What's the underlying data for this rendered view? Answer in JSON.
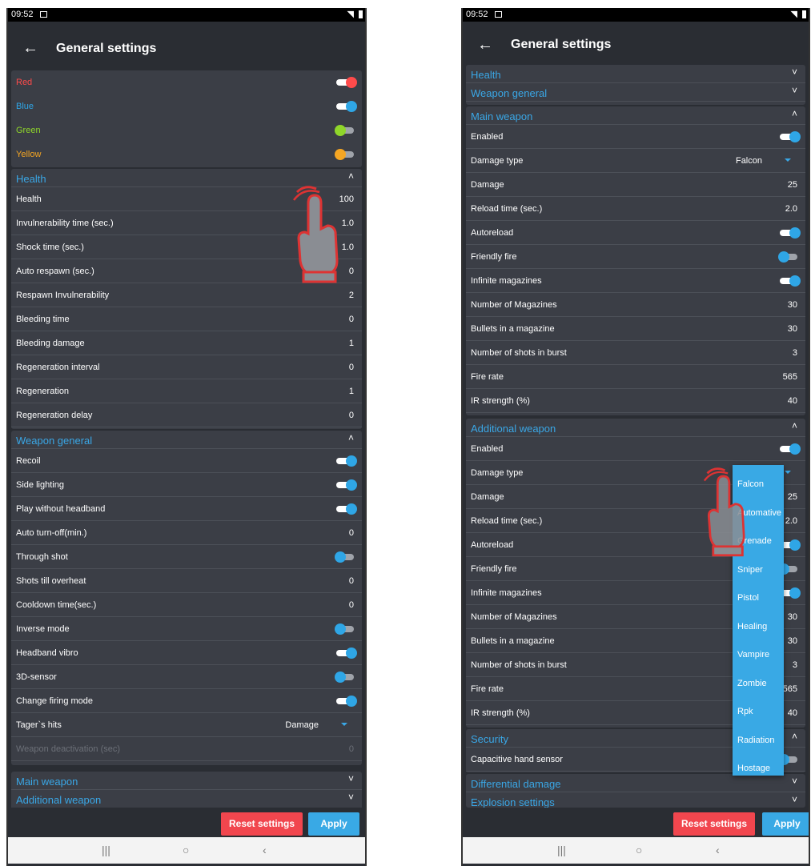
{
  "status": {
    "time": "09:52"
  },
  "left": {
    "title": "General settings",
    "colors": [
      {
        "label": "Red",
        "color": "#ff4b4b",
        "on": true
      },
      {
        "label": "Blue",
        "color": "#2fa6e6",
        "on": true
      },
      {
        "label": "Green",
        "color": "#8fd62a",
        "on": false
      },
      {
        "label": "Yellow",
        "color": "#f5a623",
        "on": false
      }
    ],
    "health": {
      "title": "Health",
      "rows": [
        {
          "label": "Health",
          "value": "100"
        },
        {
          "label": "Invulnerability time (sec.)",
          "value": "1.0"
        },
        {
          "label": "Shock time (sec.)",
          "value": "1.0"
        },
        {
          "label": "Auto respawn (sec.)",
          "value": "0"
        },
        {
          "label": "Respawn Invulnerability",
          "value": "2"
        },
        {
          "label": "Bleeding time",
          "value": "0"
        },
        {
          "label": "Bleeding damage",
          "value": "1"
        },
        {
          "label": "Regeneration interval",
          "value": "0"
        },
        {
          "label": "Regeneration",
          "value": "1"
        },
        {
          "label": "Regeneration delay",
          "value": "0"
        }
      ]
    },
    "weapon_general": {
      "title": "Weapon general",
      "rows": [
        {
          "label": "Recoil",
          "toggle": "on"
        },
        {
          "label": "Side lighting",
          "toggle": "on"
        },
        {
          "label": "Play without headband",
          "toggle": "on"
        },
        {
          "label": "Auto turn-off(min.)",
          "value": "0"
        },
        {
          "label": "Through shot",
          "toggle": "off"
        },
        {
          "label": "Shots till overheat",
          "value": "0"
        },
        {
          "label": "Cooldown time(sec.)",
          "value": "0"
        },
        {
          "label": "Inverse mode",
          "toggle": "off"
        },
        {
          "label": "Headband vibro",
          "toggle": "on"
        },
        {
          "label": "3D-sensor",
          "toggle": "off"
        },
        {
          "label": "Change firing mode",
          "toggle": "on"
        },
        {
          "label": "Tager`s hits",
          "value": "Damage",
          "select": true
        },
        {
          "label": "Weapon deactivation (sec)",
          "value": "0",
          "disabled": true
        }
      ]
    },
    "collapsed": [
      "Main weapon",
      "Additional weapon"
    ],
    "buttons": {
      "reset": "Reset settings",
      "apply": "Apply"
    }
  },
  "right": {
    "title": "General settings",
    "collapsed_top": [
      "Health",
      "Weapon general"
    ],
    "main_weapon": {
      "title": "Main weapon",
      "rows": [
        {
          "label": "Enabled",
          "toggle": "on"
        },
        {
          "label": "Damage type",
          "value": "Falcon",
          "select": true
        },
        {
          "label": "Damage",
          "value": "25"
        },
        {
          "label": "Reload time (sec.)",
          "value": "2.0"
        },
        {
          "label": "Autoreload",
          "toggle": "on"
        },
        {
          "label": "Friendly fire",
          "toggle": "off"
        },
        {
          "label": "Infinite magazines",
          "toggle": "on"
        },
        {
          "label": "Number of Magazines",
          "value": "30"
        },
        {
          "label": "Bullets in a magazine",
          "value": "30"
        },
        {
          "label": "Number of shots in burst",
          "value": "3"
        },
        {
          "label": "Fire rate",
          "value": "565"
        },
        {
          "label": "IR strength (%)",
          "value": "40"
        }
      ]
    },
    "additional_weapon": {
      "title": "Additional weapon",
      "rows": [
        {
          "label": "Enabled",
          "toggle": "on"
        },
        {
          "label": "Damage type",
          "value": "",
          "select": true
        },
        {
          "label": "Damage",
          "value": "25"
        },
        {
          "label": "Reload time (sec.)",
          "value": "2.0"
        },
        {
          "label": "Autoreload",
          "toggle": "on"
        },
        {
          "label": "Friendly fire",
          "toggle": "off"
        },
        {
          "label": "Infinite magazines",
          "toggle": "on"
        },
        {
          "label": "Number of Magazines",
          "value": "30"
        },
        {
          "label": "Bullets in a magazine",
          "value": "30"
        },
        {
          "label": "Number of shots in burst",
          "value": "3"
        },
        {
          "label": "Fire rate",
          "value": "565"
        },
        {
          "label": "IR strength (%)",
          "value": "40"
        }
      ]
    },
    "security": {
      "title": "Security",
      "rows": [
        {
          "label": "Capacitive hand sensor",
          "toggle": "off"
        }
      ]
    },
    "collapsed_bottom": [
      "Differential damage",
      "Explosion settings"
    ],
    "dropdown": [
      "Falcon",
      "Automative",
      "Grenade",
      "Sniper",
      "Pistol",
      "Healing",
      "Vampire",
      "Zombie",
      "Rpk",
      "Radiation",
      "Hostage"
    ],
    "buttons": {
      "reset": "Reset settings",
      "apply": "Apply"
    }
  },
  "icons": {
    "back": "arrow-left-icon",
    "expand": "chevron-up-icon",
    "collapse": "chevron-down-icon",
    "nav_recent": "recent-apps-icon",
    "nav_home": "home-icon",
    "nav_back": "back-icon",
    "hand": "tap-hand-icon"
  }
}
